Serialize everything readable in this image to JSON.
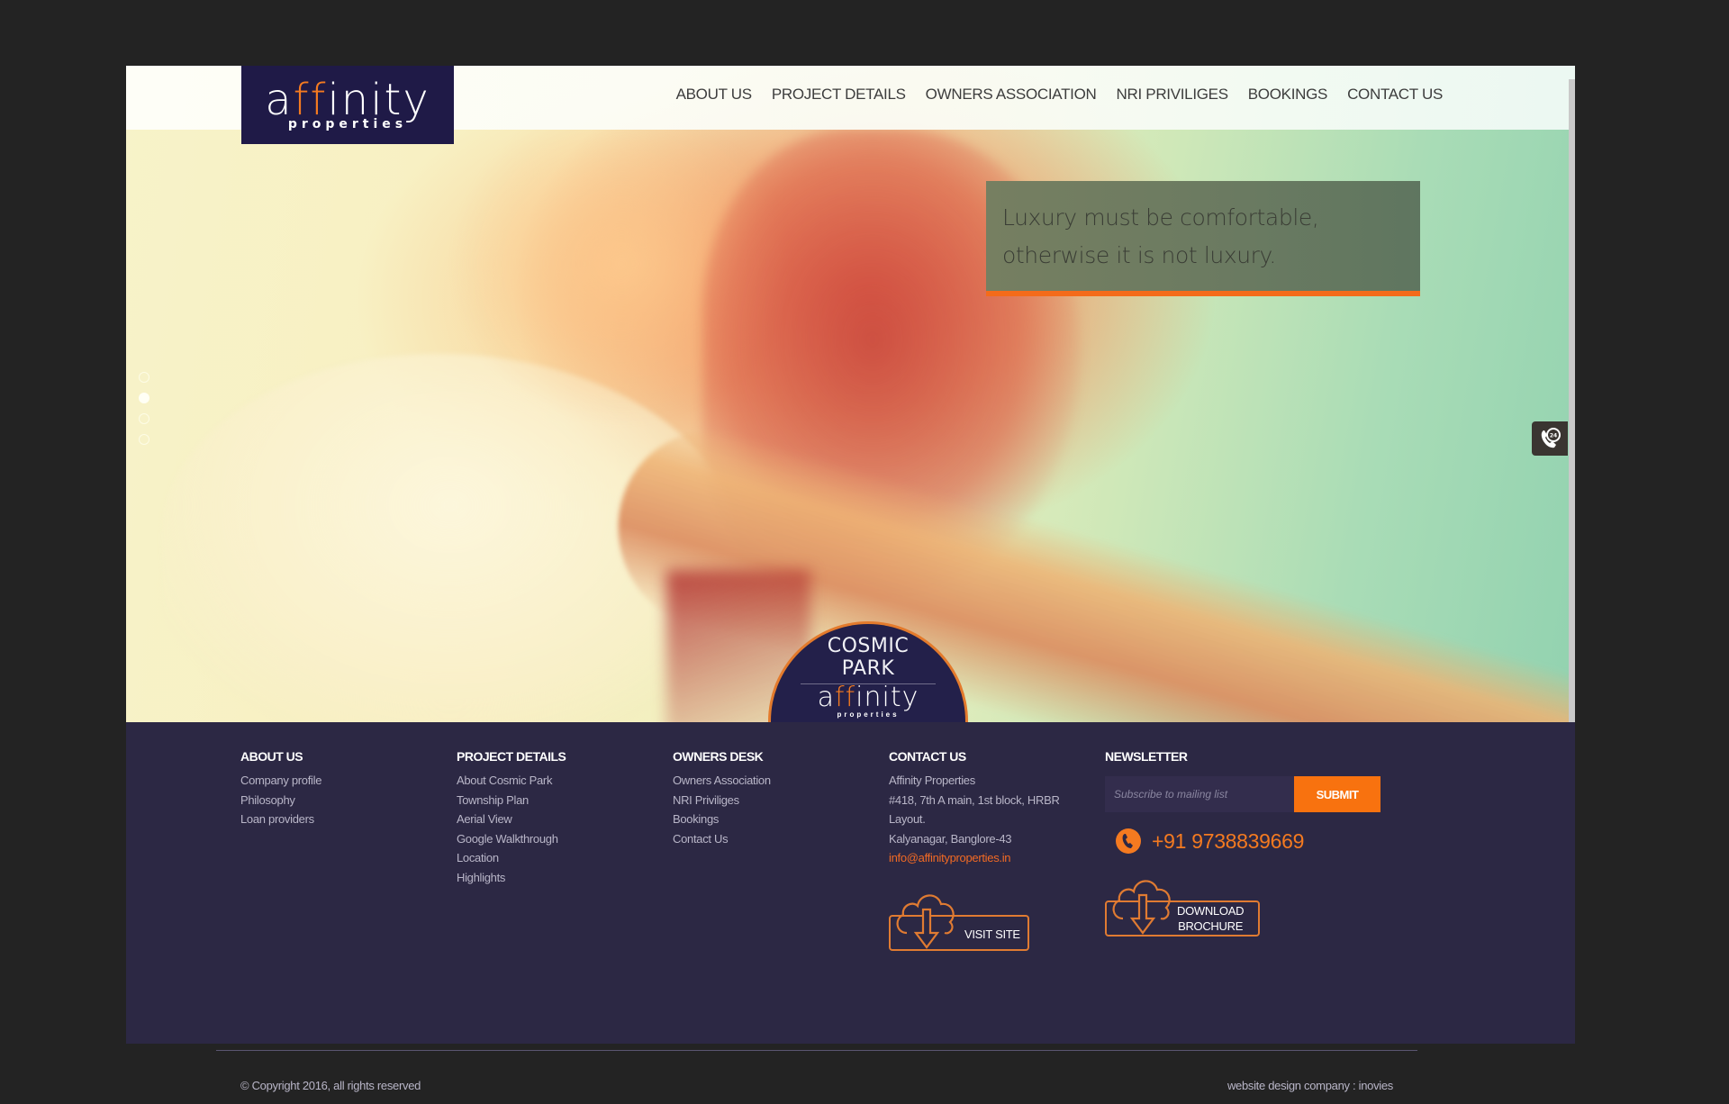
{
  "header": {
    "logo": {
      "word_pre": "a",
      "word_accent": "ff",
      "word_post": "inity",
      "sub": "properties"
    },
    "nav": [
      {
        "label": "ABOUT US"
      },
      {
        "label": "PROJECT DETAILS"
      },
      {
        "label": "OWNERS ASSOCIATION"
      },
      {
        "label": "NRI PRIVILIGES"
      },
      {
        "label": "BOOKINGS"
      },
      {
        "label": "CONTACT US"
      }
    ]
  },
  "hero": {
    "quote_line1": "Luxury must be comfortable,",
    "quote_line2": "otherwise it is not luxury.",
    "slider": {
      "total": 4,
      "active_index": 2
    },
    "call_widget_icon": "phone-24-icon",
    "badge": {
      "title_line1": "COSMIC",
      "title_line2": "PARK",
      "logo_pre": "a",
      "logo_accent": "ff",
      "logo_post": "inity",
      "logo_sub": "properties"
    }
  },
  "footer": {
    "columns": [
      {
        "title": "ABOUT US",
        "links": [
          "Company profile",
          "Philosophy",
          "Loan providers"
        ]
      },
      {
        "title": "PROJECT DETAILS",
        "links": [
          "About Cosmic Park",
          "Township Plan",
          "Aerial View",
          "Google Walkthrough",
          "Location",
          "Highlights"
        ]
      },
      {
        "title": "OWNERS DESK",
        "links": [
          "Owners Association",
          "NRI Priviliges",
          "Bookings",
          "Contact Us"
        ]
      }
    ],
    "contact": {
      "title": "CONTACT US",
      "company": "Affinity Properties",
      "address1": "#418, 7th A main, 1st block, HRBR",
      "address2": "Layout.",
      "address3": "Kalyanagar, Banglore-43",
      "email": "info@affinityproperties.in",
      "visit_site_label": "VISIT SITE"
    },
    "newsletter": {
      "title": "NEWSLETTER",
      "placeholder": "Subscribe to mailing list",
      "submit_label": "SUBMIT",
      "phone": "+91 9738839669",
      "download_line1": "DOWNLOAD",
      "download_line2": "BROCHURE"
    },
    "copyright": "© Copyright 2016, all rights reserved",
    "credit": "website design company : inovies"
  },
  "colors": {
    "accent": "#f47a20",
    "footer_bg": "#2c2844",
    "logo_bg": "#1f1a47",
    "page_bg": "#232323"
  }
}
